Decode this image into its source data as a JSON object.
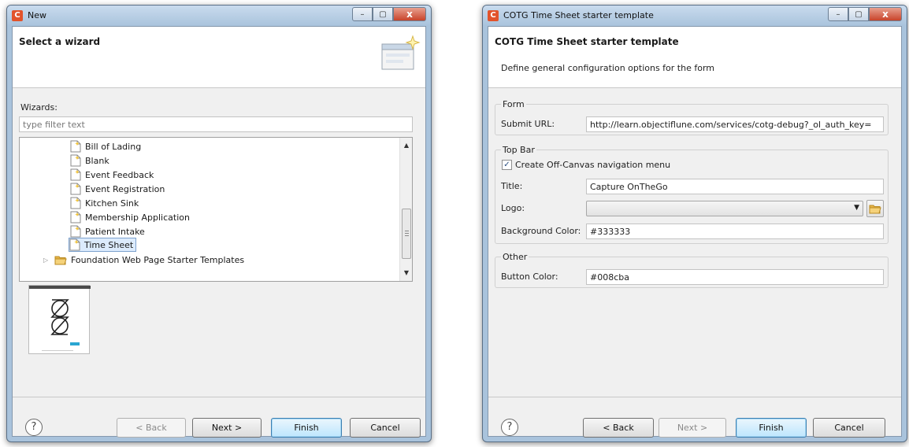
{
  "left_window": {
    "title": "New",
    "header_title": "Select a wizard",
    "wizards_label": "Wizards:",
    "filter_placeholder": "type filter text",
    "tree_items": [
      {
        "label": "Bill of Lading"
      },
      {
        "label": "Blank"
      },
      {
        "label": "Event Feedback"
      },
      {
        "label": "Event Registration"
      },
      {
        "label": "Kitchen Sink"
      },
      {
        "label": "Membership Application"
      },
      {
        "label": "Patient Intake"
      },
      {
        "label": "Time Sheet",
        "selected": true
      }
    ],
    "folder_item": "Foundation Web Page Starter Templates",
    "buttons": {
      "back": "< Back",
      "next": "Next >",
      "finish": "Finish",
      "cancel": "Cancel"
    },
    "help": "?"
  },
  "right_window": {
    "title": "COTG Time Sheet starter template",
    "header_title": "COTG Time Sheet starter template",
    "header_desc": "Define general configuration options for the form",
    "form_group": {
      "title": "Form",
      "submit_url_label": "Submit URL:",
      "submit_url_value": "http://learn.objectiflune.com/services/cotg-debug?_ol_auth_key="
    },
    "topbar_group": {
      "title": "Top Bar",
      "offcanvas_label": "Create Off-Canvas navigation menu",
      "offcanvas_checked": true,
      "title_label": "Title:",
      "title_value": "Capture OnTheGo",
      "logo_label": "Logo:",
      "logo_value": "",
      "bg_color_label": "Background Color:",
      "bg_color_value": "#333333"
    },
    "other_group": {
      "title": "Other",
      "button_color_label": "Button Color:",
      "button_color_value": "#008cba"
    },
    "buttons": {
      "back": "< Back",
      "next": "Next >",
      "finish": "Finish",
      "cancel": "Cancel"
    },
    "help": "?"
  },
  "window_controls": {
    "minimize": "–",
    "maximize": "▢",
    "close": "x"
  },
  "app_icon_letter": "C",
  "colors": {
    "window_frame": "#a9c3dc",
    "client_bg": "#f0f0f0",
    "selection": "#dcebfc",
    "close_button": "#c8432a",
    "app_icon": "#e2532b"
  }
}
